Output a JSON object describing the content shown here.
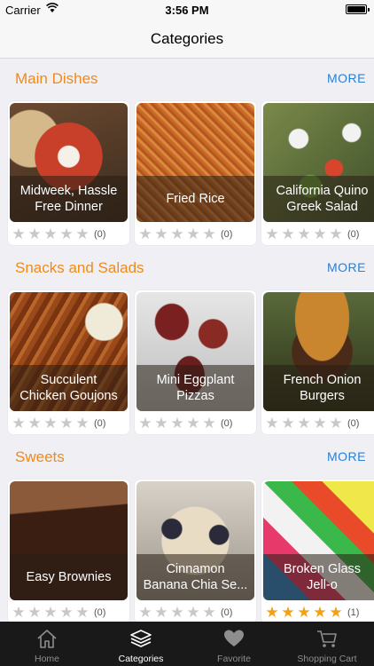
{
  "status": {
    "carrier": "Carrier",
    "time": "3:56 PM"
  },
  "nav": {
    "title": "Categories"
  },
  "colors": {
    "accent_orange": "#f08a1a",
    "link_blue": "#2a7fd4",
    "star_on": "#f5a012",
    "star_off": "#c8c8c8"
  },
  "sections": [
    {
      "title": "Main Dishes",
      "more": "MORE",
      "cards": [
        {
          "caption": "Midweek, Hassle\nFree Dinner",
          "stars": 0,
          "count": "(0)"
        },
        {
          "caption": "Fried Rice",
          "stars": 0,
          "count": "(0)"
        },
        {
          "caption": "California Quino\nGreek Salad",
          "stars": 0,
          "count": "(0)"
        }
      ]
    },
    {
      "title": "Snacks and Salads",
      "more": "MORE",
      "cards": [
        {
          "caption": "Succulent\nChicken Goujons",
          "stars": 0,
          "count": "(0)"
        },
        {
          "caption": "Mini Eggplant\nPizzas",
          "stars": 0,
          "count": "(0)"
        },
        {
          "caption": "French Onion\nBurgers",
          "stars": 0,
          "count": "(0)"
        }
      ]
    },
    {
      "title": "Sweets",
      "more": "MORE",
      "cards": [
        {
          "caption": "Easy Brownies",
          "stars": 0,
          "count": "(0)"
        },
        {
          "caption": "Cinnamon\nBanana Chia Se...",
          "stars": 0,
          "count": "(0)"
        },
        {
          "caption": "Broken Glass\nJell-o",
          "stars": 5,
          "count": "(1)"
        }
      ]
    }
  ],
  "tabs": [
    {
      "label": "Home",
      "icon": "home-icon"
    },
    {
      "label": "Categories",
      "icon": "layers-icon",
      "active": true
    },
    {
      "label": "Favorite",
      "icon": "heart-icon"
    },
    {
      "label": "Shopping Cart",
      "icon": "cart-icon"
    }
  ]
}
